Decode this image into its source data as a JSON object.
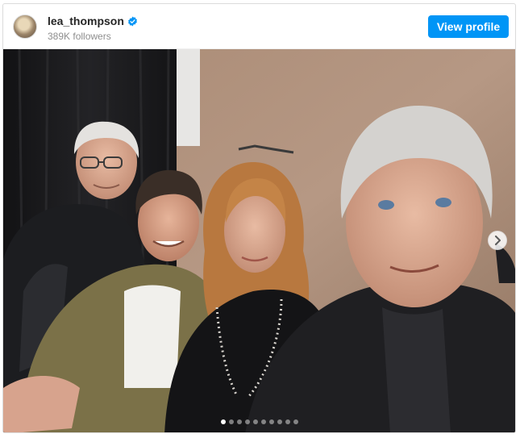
{
  "header": {
    "username": "lea_thompson",
    "followers": "389K followers",
    "view_profile_label": "View profile",
    "verified_color": "#0095f6"
  },
  "media": {
    "icons": {
      "next": "chevron-right-icon",
      "verified": "verified-badge-icon"
    },
    "carousel": {
      "total": 10,
      "active_index": 0
    }
  }
}
